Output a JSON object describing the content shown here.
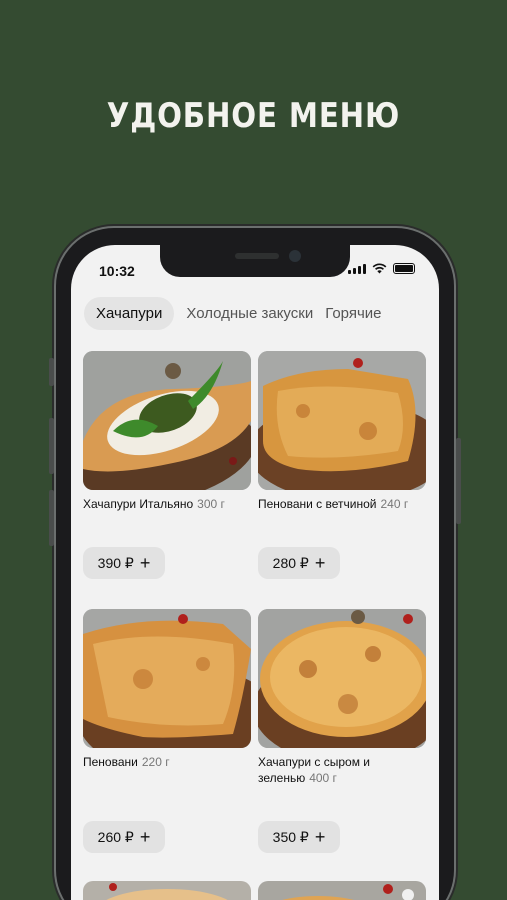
{
  "headline": "УДОБНОЕ МЕНЮ",
  "status": {
    "time": "10:32"
  },
  "tabs": [
    "Хачапури",
    "Холодные закуски",
    "Горячие"
  ],
  "items": [
    {
      "name": "Хачапури Итальяно",
      "weight": "300 г",
      "price": "390 ₽",
      "plus": "+"
    },
    {
      "name": "Пеновани с ветчиной",
      "weight": "240 г",
      "price": "280 ₽",
      "plus": "+"
    },
    {
      "name": "Пеновани",
      "weight": "220 г",
      "price": "260 ₽",
      "plus": "+"
    },
    {
      "name": "Хачапури с сыром и зеленью",
      "weight": "400 г",
      "price": "350 ₽",
      "plus": "+"
    }
  ]
}
